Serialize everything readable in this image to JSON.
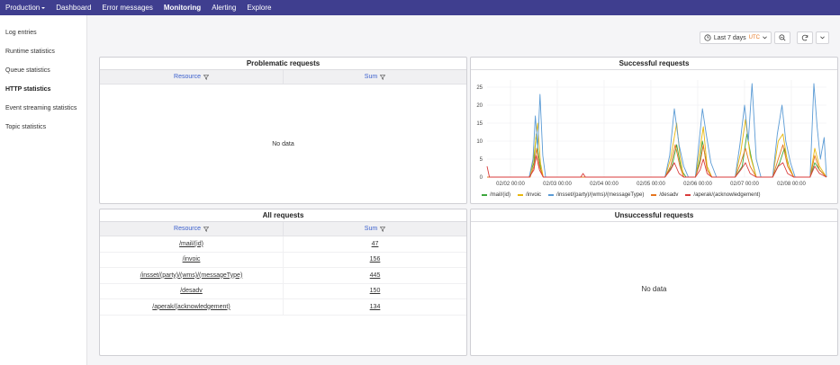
{
  "nav": {
    "items": [
      {
        "label": "Production",
        "dropdown": true,
        "active": false
      },
      {
        "label": "Dashboard",
        "active": false
      },
      {
        "label": "Error messages",
        "active": false
      },
      {
        "label": "Monitoring",
        "active": true
      },
      {
        "label": "Alerting",
        "active": false
      },
      {
        "label": "Explore",
        "active": false
      }
    ]
  },
  "sidebar": {
    "items": [
      {
        "label": "Log entries",
        "active": false
      },
      {
        "label": "Runtime statistics",
        "active": false
      },
      {
        "label": "Queue statistics",
        "active": false
      },
      {
        "label": "HTTP statistics",
        "active": true
      },
      {
        "label": "Event streaming statistics",
        "active": false
      },
      {
        "label": "Topic statistics",
        "active": false
      }
    ]
  },
  "toolbar": {
    "time_range": "Last 7 days",
    "timezone": "UTC"
  },
  "panels": {
    "problematic": {
      "title": "Problematic requests",
      "col_resource": "Resource",
      "col_sum": "Sum",
      "empty": "No data"
    },
    "successful": {
      "title": "Successful requests"
    },
    "all": {
      "title": "All requests",
      "col_resource": "Resource",
      "col_sum": "Sum",
      "rows": [
        {
          "resource": "/mail/(id)",
          "sum": "47"
        },
        {
          "resource": "/invoic",
          "sum": "156"
        },
        {
          "resource": "/insset/(party)/(wms)/(messageType)",
          "sum": "445"
        },
        {
          "resource": "/desadv",
          "sum": "150"
        },
        {
          "resource": "/aperak/(acknowledgement)",
          "sum": "134"
        }
      ]
    },
    "unsuccessful": {
      "title": "Unsuccessful requests",
      "empty": "No data"
    }
  },
  "chart_data": {
    "type": "line",
    "ylim": [
      0,
      27
    ],
    "yticks": [
      0,
      5,
      10,
      15,
      20,
      25
    ],
    "xrange": [
      0,
      7.25
    ],
    "xticks": [
      {
        "x": 0.5,
        "label": "02/02 00:00"
      },
      {
        "x": 1.5,
        "label": "02/03 00:00"
      },
      {
        "x": 2.5,
        "label": "02/04 00:00"
      },
      {
        "x": 3.5,
        "label": "02/05 00:00"
      },
      {
        "x": 4.5,
        "label": "02/06 00:00"
      },
      {
        "x": 5.5,
        "label": "02/07 00:00"
      },
      {
        "x": 6.5,
        "label": "02/08 00:00"
      }
    ],
    "series": [
      {
        "name": "/mail/(id)",
        "color": "#3da63d",
        "points": [
          [
            0,
            0
          ],
          [
            0.9,
            0
          ],
          [
            1.0,
            4
          ],
          [
            1.05,
            12
          ],
          [
            1.1,
            6
          ],
          [
            1.15,
            2
          ],
          [
            1.2,
            0
          ],
          [
            3.8,
            0
          ],
          [
            3.95,
            3
          ],
          [
            4.05,
            9
          ],
          [
            4.15,
            2
          ],
          [
            4.25,
            0
          ],
          [
            4.45,
            0
          ],
          [
            4.55,
            5
          ],
          [
            4.6,
            10
          ],
          [
            4.7,
            3
          ],
          [
            4.8,
            0
          ],
          [
            5.3,
            0
          ],
          [
            5.45,
            3
          ],
          [
            5.55,
            12
          ],
          [
            5.65,
            5
          ],
          [
            5.75,
            0
          ],
          [
            6.1,
            0
          ],
          [
            6.25,
            4
          ],
          [
            6.35,
            8
          ],
          [
            6.45,
            3
          ],
          [
            6.55,
            0
          ],
          [
            6.9,
            0
          ],
          [
            7.0,
            4
          ],
          [
            7.1,
            2
          ],
          [
            7.25,
            0
          ]
        ]
      },
      {
        "name": "/invoic",
        "color": "#e8b80f",
        "points": [
          [
            0,
            0
          ],
          [
            0.92,
            0
          ],
          [
            1.0,
            6
          ],
          [
            1.08,
            15
          ],
          [
            1.14,
            4
          ],
          [
            1.2,
            0
          ],
          [
            3.8,
            0
          ],
          [
            3.92,
            5
          ],
          [
            4.05,
            15
          ],
          [
            4.12,
            6
          ],
          [
            4.2,
            0
          ],
          [
            4.45,
            0
          ],
          [
            4.55,
            8
          ],
          [
            4.62,
            14
          ],
          [
            4.7,
            3
          ],
          [
            4.8,
            0
          ],
          [
            5.3,
            0
          ],
          [
            5.42,
            7
          ],
          [
            5.52,
            16
          ],
          [
            5.62,
            6
          ],
          [
            5.75,
            0
          ],
          [
            6.1,
            0
          ],
          [
            6.22,
            10
          ],
          [
            6.32,
            12
          ],
          [
            6.42,
            4
          ],
          [
            6.55,
            0
          ],
          [
            6.9,
            0
          ],
          [
            7.0,
            8
          ],
          [
            7.1,
            3
          ],
          [
            7.25,
            0
          ]
        ]
      },
      {
        "name": "/insset/(party)/(wms)/(messageType)",
        "color": "#5b9bd5",
        "points": [
          [
            0,
            0
          ],
          [
            0.9,
            0
          ],
          [
            0.98,
            5
          ],
          [
            1.03,
            17
          ],
          [
            1.08,
            8
          ],
          [
            1.13,
            23
          ],
          [
            1.19,
            6
          ],
          [
            1.25,
            0
          ],
          [
            3.8,
            0
          ],
          [
            3.9,
            6
          ],
          [
            4.0,
            19
          ],
          [
            4.1,
            9
          ],
          [
            4.2,
            3
          ],
          [
            4.3,
            0
          ],
          [
            4.45,
            0
          ],
          [
            4.53,
            10
          ],
          [
            4.6,
            19
          ],
          [
            4.68,
            12
          ],
          [
            4.78,
            4
          ],
          [
            4.9,
            0
          ],
          [
            5.3,
            0
          ],
          [
            5.4,
            9
          ],
          [
            5.5,
            20
          ],
          [
            5.58,
            10
          ],
          [
            5.66,
            26
          ],
          [
            5.75,
            5
          ],
          [
            5.85,
            0
          ],
          [
            6.1,
            0
          ],
          [
            6.2,
            12
          ],
          [
            6.3,
            20
          ],
          [
            6.38,
            10
          ],
          [
            6.48,
            4
          ],
          [
            6.58,
            0
          ],
          [
            6.9,
            0
          ],
          [
            6.98,
            26
          ],
          [
            7.05,
            14
          ],
          [
            7.12,
            5
          ],
          [
            7.2,
            11
          ],
          [
            7.25,
            0
          ]
        ]
      },
      {
        "name": "/desadv",
        "color": "#e5751e",
        "points": [
          [
            0,
            0
          ],
          [
            0.92,
            0
          ],
          [
            1.0,
            3
          ],
          [
            1.06,
            8
          ],
          [
            1.12,
            3
          ],
          [
            1.2,
            0
          ],
          [
            3.8,
            0
          ],
          [
            3.92,
            3
          ],
          [
            4.02,
            9
          ],
          [
            4.12,
            3
          ],
          [
            4.2,
            0
          ],
          [
            4.45,
            0
          ],
          [
            4.55,
            4
          ],
          [
            4.62,
            9
          ],
          [
            4.7,
            2
          ],
          [
            4.8,
            0
          ],
          [
            5.3,
            0
          ],
          [
            5.42,
            4
          ],
          [
            5.52,
            8
          ],
          [
            5.62,
            3
          ],
          [
            5.75,
            0
          ],
          [
            6.1,
            0
          ],
          [
            6.22,
            5
          ],
          [
            6.32,
            9
          ],
          [
            6.42,
            3
          ],
          [
            6.55,
            0
          ],
          [
            6.9,
            0
          ],
          [
            7.0,
            6
          ],
          [
            7.1,
            2
          ],
          [
            7.25,
            0
          ]
        ]
      },
      {
        "name": "/aperak/(acknowledgement)",
        "color": "#d93b3b",
        "points": [
          [
            0,
            3
          ],
          [
            0.05,
            0
          ],
          [
            0.9,
            0
          ],
          [
            1.0,
            2
          ],
          [
            1.05,
            6
          ],
          [
            1.12,
            2
          ],
          [
            1.2,
            0
          ],
          [
            2.0,
            0
          ],
          [
            2.05,
            1
          ],
          [
            2.1,
            0
          ],
          [
            3.8,
            0
          ],
          [
            3.92,
            2
          ],
          [
            4.0,
            4
          ],
          [
            4.1,
            1
          ],
          [
            4.2,
            0
          ],
          [
            4.45,
            0
          ],
          [
            4.55,
            2
          ],
          [
            4.62,
            5
          ],
          [
            4.7,
            1
          ],
          [
            4.8,
            0
          ],
          [
            5.3,
            0
          ],
          [
            5.42,
            2
          ],
          [
            5.52,
            4
          ],
          [
            5.62,
            1
          ],
          [
            5.75,
            0
          ],
          [
            6.1,
            0
          ],
          [
            6.22,
            3
          ],
          [
            6.32,
            4
          ],
          [
            6.42,
            1
          ],
          [
            6.55,
            0
          ],
          [
            6.9,
            0
          ],
          [
            7.0,
            3
          ],
          [
            7.1,
            1
          ],
          [
            7.25,
            0
          ]
        ]
      }
    ]
  }
}
